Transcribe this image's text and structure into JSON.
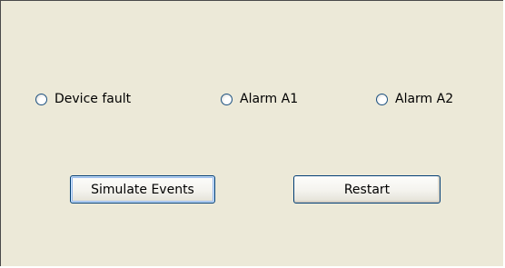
{
  "options": [
    {
      "label": "Device fault"
    },
    {
      "label": "Alarm A1"
    },
    {
      "label": "Alarm A2"
    }
  ],
  "buttons": {
    "simulate_label": "Simulate Events",
    "restart_label": "Restart"
  },
  "colors": {
    "panel_bg": "#ece9d8",
    "button_border": "#003c74",
    "radio_border": "#1c5180"
  },
  "icons": {
    "radio": "radio-button-icon"
  }
}
